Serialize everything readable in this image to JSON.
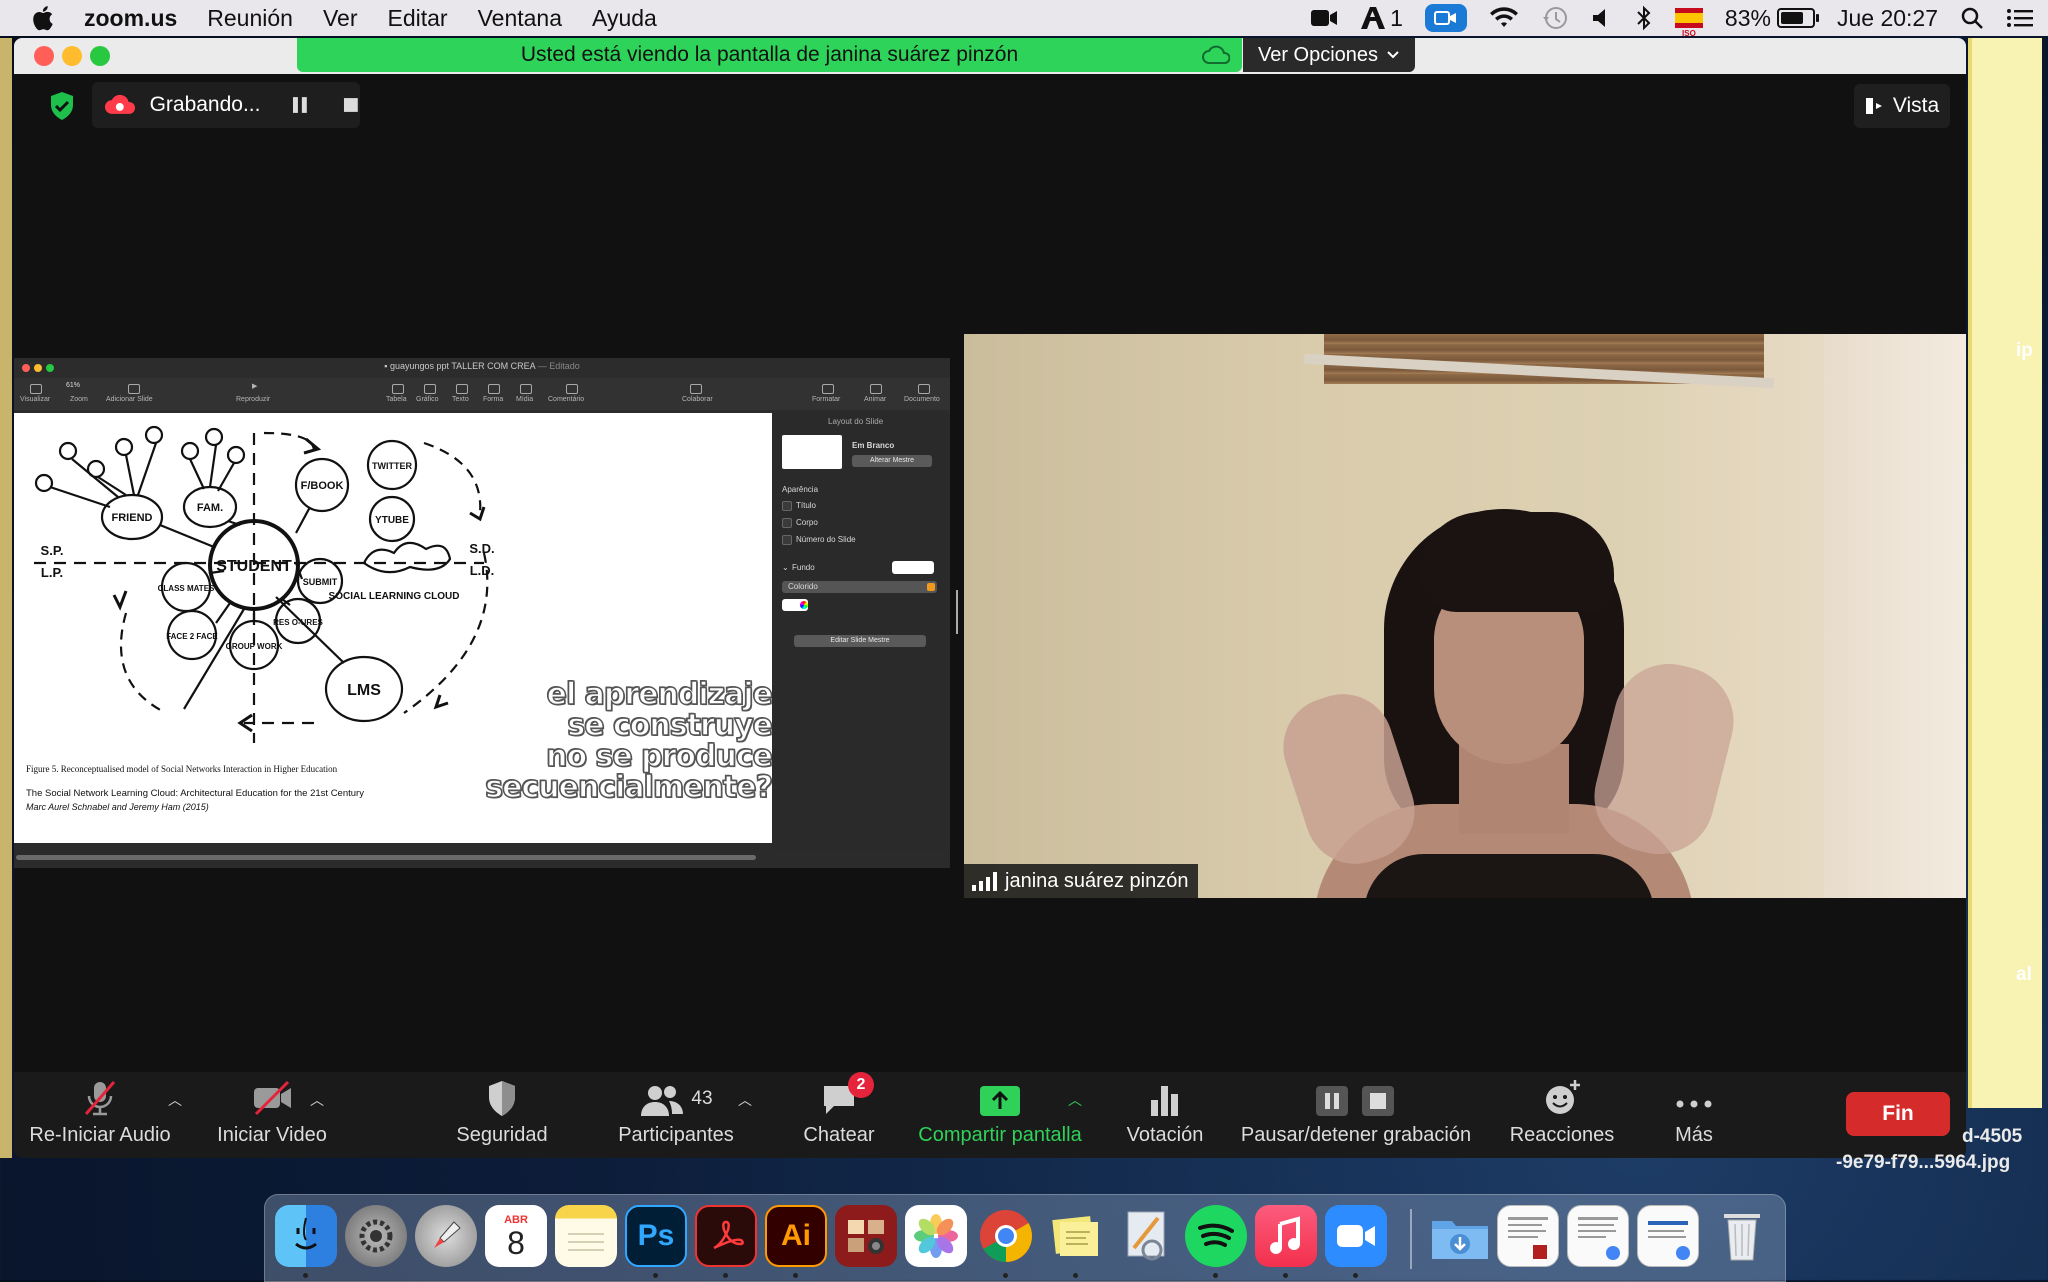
{
  "menubar": {
    "app_name": "zoom.us",
    "menus": [
      "Reunión",
      "Ver",
      "Editar",
      "Ventana",
      "Ayuda"
    ],
    "status_count": "1",
    "battery_percent": "83%",
    "battery_level": 0.83,
    "clock": "Jue 20:27",
    "flag_text": "ISO"
  },
  "zoom": {
    "banner_text": "Usted está viendo la pantalla de janina suárez pinzón",
    "view_options": "Ver Opciones",
    "recording_label": "Grabando...",
    "view_label": "Vista",
    "speaker_name": "janina suárez pinzón"
  },
  "shared_screen": {
    "window_title": "guayungos ppt TALLER COM CREA",
    "window_title_suffix": "— Editado",
    "zoom_level": "61%",
    "toolbar_left": [
      "Visualizar",
      "Zoom",
      "Adicionar Slide"
    ],
    "toolbar_play": "Reproduzir",
    "toolbar_mid": [
      "Tabela",
      "Gráfico",
      "Texto",
      "Forma",
      "Mídia",
      "Comentário"
    ],
    "toolbar_collab": "Colaborar",
    "toolbar_right": [
      "Formatar",
      "Animar",
      "Documento"
    ],
    "slide": {
      "diagram_labels": [
        "FRIEND",
        "FAM.",
        "STUDENT",
        "F/BOOK",
        "TWITTER",
        "YTUBE",
        "CLASS MATES",
        "SUBMIT",
        "SOCIAL LEARNING CLOUD",
        "RES O-URES",
        "FACE 2 FACE",
        "GROUP WORK",
        "LMS",
        "S.P.",
        "L.P.",
        "S.D.",
        "L.D."
      ],
      "figure_caption": "Figure 5. Reconceptualised model of Social Networks Interaction in Higher Education",
      "citation": "The Social Network Learning Cloud: Architectural Education for the 21st Century",
      "authors": "Marc Aurel Schnabel and Jeremy Ham (2015)",
      "quote_lines": [
        "el aprendizaje",
        "se construye",
        "no se produce",
        "secuencialmente?"
      ]
    },
    "inspector": {
      "header": "Layout do Slide",
      "layout_name": "Em Branco",
      "change_master": "Alterar Mestre",
      "appearance": "Aparência",
      "options": [
        "Título",
        "Corpo",
        "Número do Slide"
      ],
      "background": "Fundo",
      "fill_type": "Colorido",
      "edit_master": "Editar Slide Mestre"
    }
  },
  "toolbar": {
    "audio": "Re-Iniciar Audio",
    "video": "Iniciar Video",
    "security": "Seguridad",
    "participants": "Participantes",
    "participants_count": "43",
    "chat": "Chatear",
    "chat_badge": "2",
    "share": "Compartir pantalla",
    "poll": "Votación",
    "recording": "Pausar/detener grabación",
    "reactions": "Reacciones",
    "more": "Más",
    "end": "Fin"
  },
  "desktop": {
    "file_line1": "d-4505",
    "file_line2": "-9e79-f79...5964.jpg",
    "side_text_1": "ip",
    "side_text_2": "al"
  },
  "dock": {
    "calendar_month": "ABR",
    "calendar_day": "8",
    "apps": [
      "Finder",
      "Preferencias del Sistema",
      "Launchpad",
      "Calendario",
      "Notas",
      "Photoshop",
      "Acrobat",
      "Illustrator",
      "Photo Booth",
      "Fotos",
      "Chrome",
      "Stickies",
      "Vista Previa",
      "Spotify",
      "Música",
      "Zoom",
      "Descargas",
      "Documento 1",
      "Documento 2",
      "Documento 3",
      "Papelera"
    ],
    "ps_label": "Ps",
    "ai_label": "Ai"
  },
  "colors": {
    "banner_green": "#2ed45a",
    "end_red": "#d62b2b",
    "share_green": "#30d158",
    "badge_red": "#e5243b"
  }
}
